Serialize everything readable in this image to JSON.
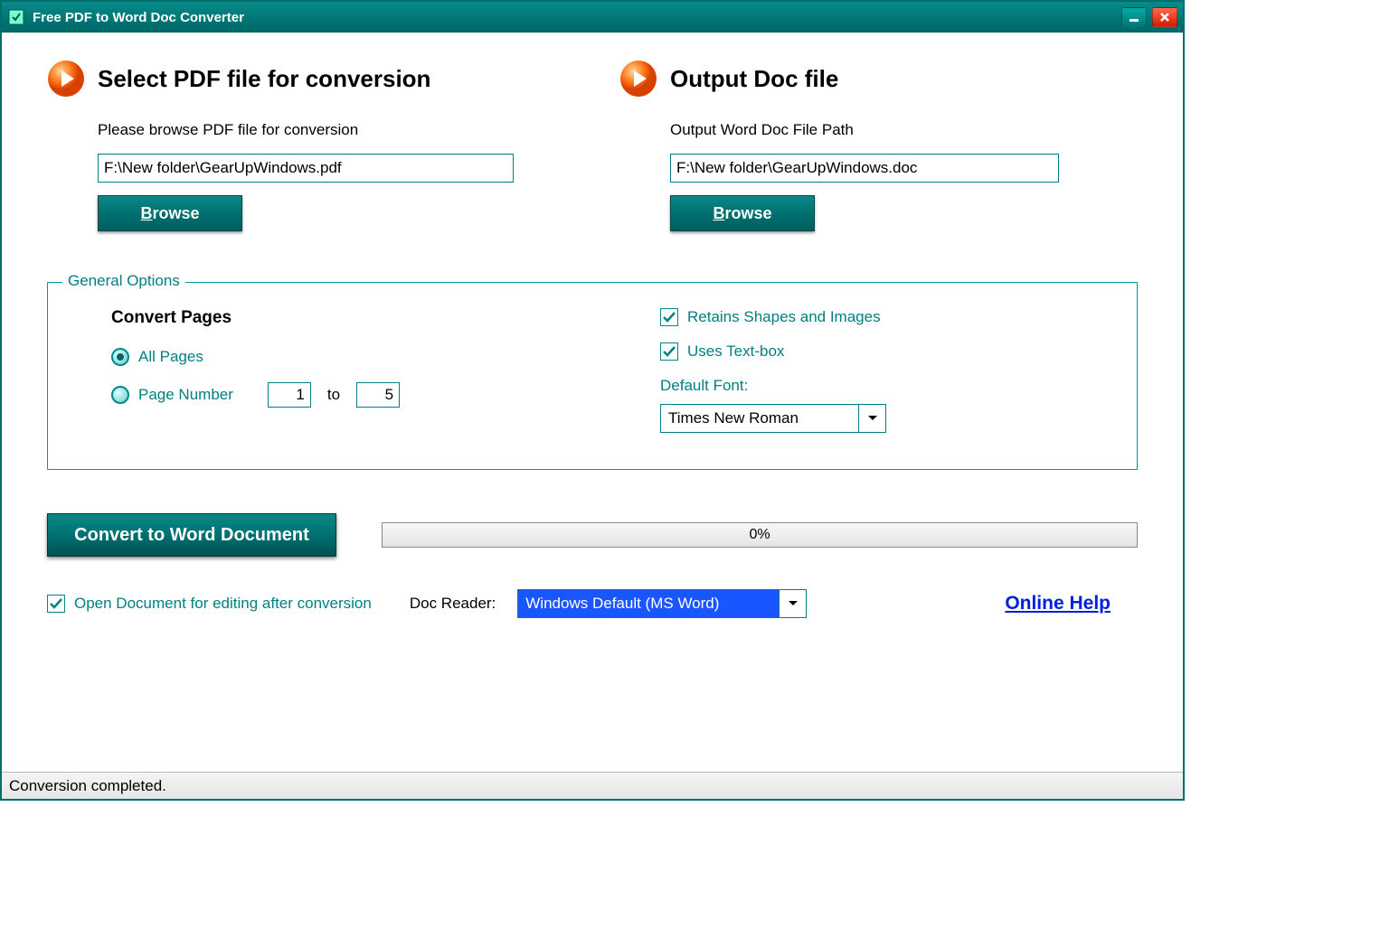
{
  "titlebar": {
    "title": "Free PDF to Word Doc Converter"
  },
  "input_panel": {
    "heading": "Select PDF file for conversion",
    "label": "Please browse PDF file for conversion",
    "path": "F:\\New folder\\GearUpWindows.pdf",
    "browse": "Browse"
  },
  "output_panel": {
    "heading": "Output Doc file",
    "label": "Output Word Doc File Path",
    "path": "F:\\New folder\\GearUpWindows.doc",
    "browse": "Browse"
  },
  "options": {
    "legend": "General Options",
    "convert_pages_title": "Convert Pages",
    "all_pages": "All Pages",
    "page_number_label": "Page Number",
    "page_from": "1",
    "page_to_label": "to",
    "page_to": "5",
    "retain_shapes": "Retains Shapes and Images",
    "uses_textbox": "Uses Text-box",
    "default_font_label": "Default Font:",
    "default_font_value": "Times New Roman"
  },
  "actions": {
    "convert": "Convert to Word Document",
    "progress": "0%"
  },
  "footer": {
    "open_after": "Open Document for editing after conversion",
    "reader_label": "Doc Reader:",
    "reader_value": "Windows Default (MS Word)",
    "help": "Online Help"
  },
  "status": {
    "text": "Conversion completed."
  }
}
